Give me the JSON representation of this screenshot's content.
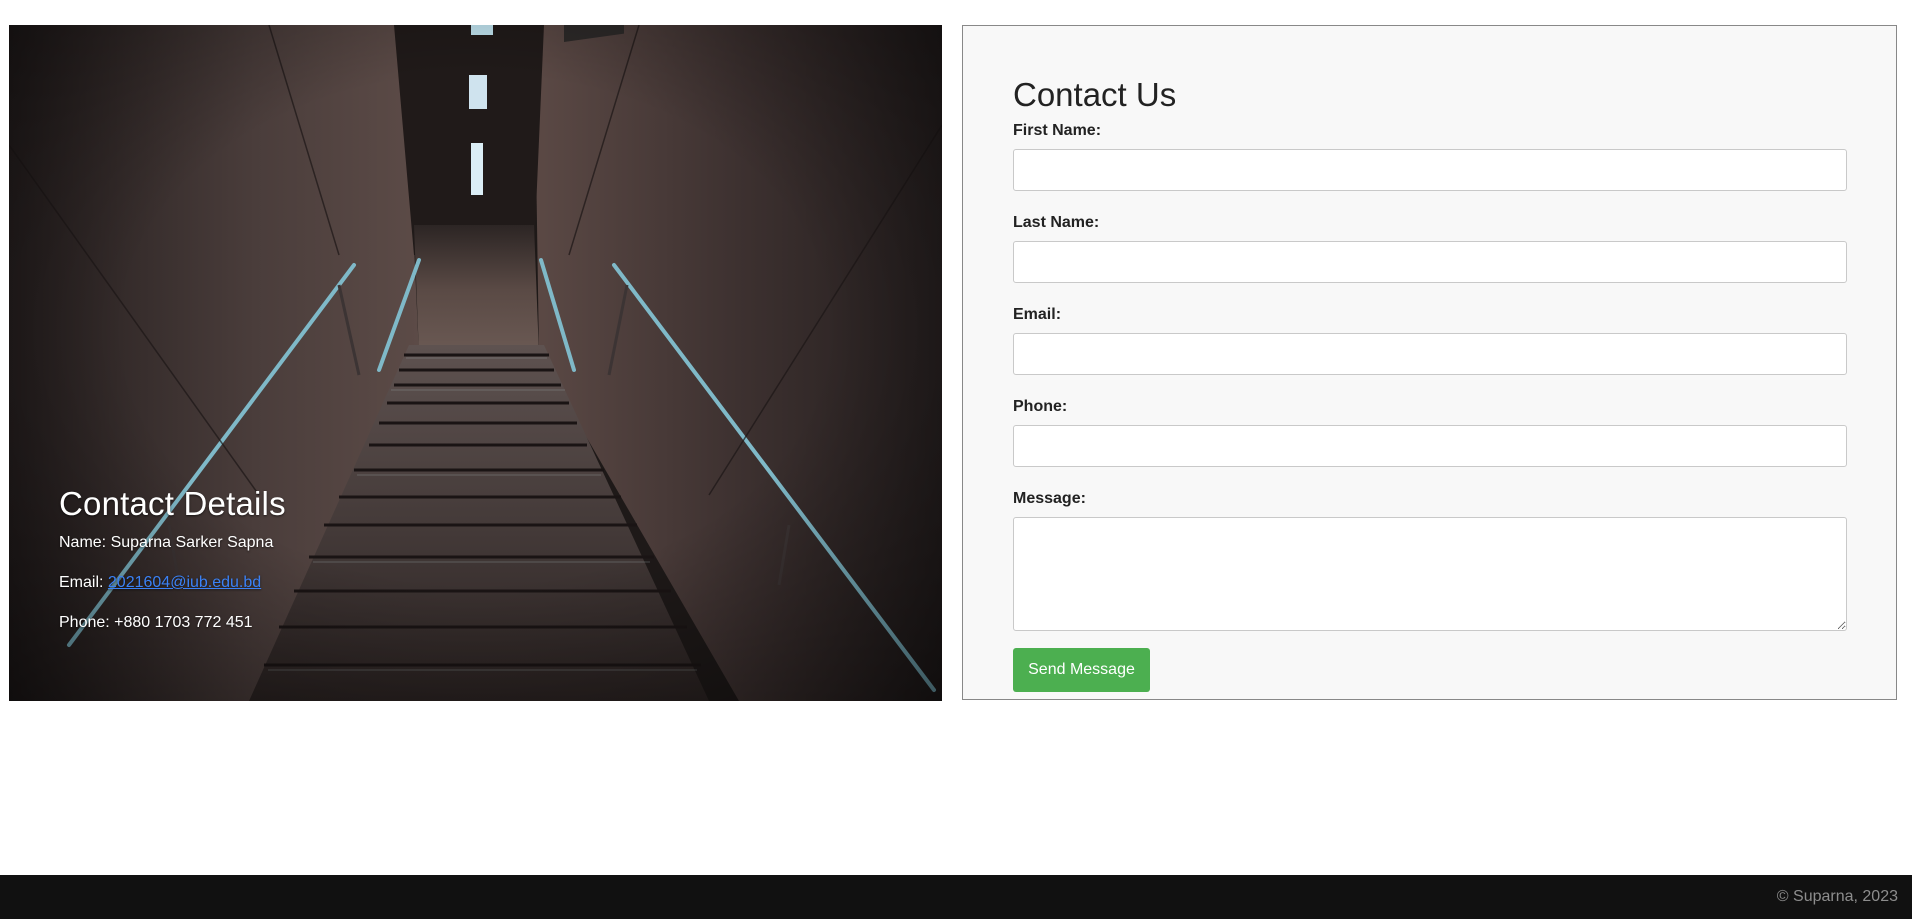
{
  "contact_details": {
    "title": "Contact Details",
    "name_line": "Name: Suparna Sarker Sapna",
    "email_prefix": "Email: ",
    "email_link": "2021604@iub.edu.bd",
    "phone_line": "Phone: +880 1703 772 451"
  },
  "form": {
    "title": "Contact Us",
    "first_name_label": "First Name:",
    "first_name_value": "",
    "last_name_label": "Last Name:",
    "last_name_value": "",
    "email_label": "Email:",
    "email_value": "",
    "phone_label": "Phone:",
    "phone_value": "",
    "message_label": "Message:",
    "message_value": "",
    "submit_label": "Send Message"
  },
  "footer": {
    "copyright": "© Suparna, 2023"
  },
  "colors": {
    "button_green": "#4caf50",
    "link_blue": "#3b82f6",
    "footer_bg": "#111111",
    "panel_bg": "#f8f8f8"
  }
}
